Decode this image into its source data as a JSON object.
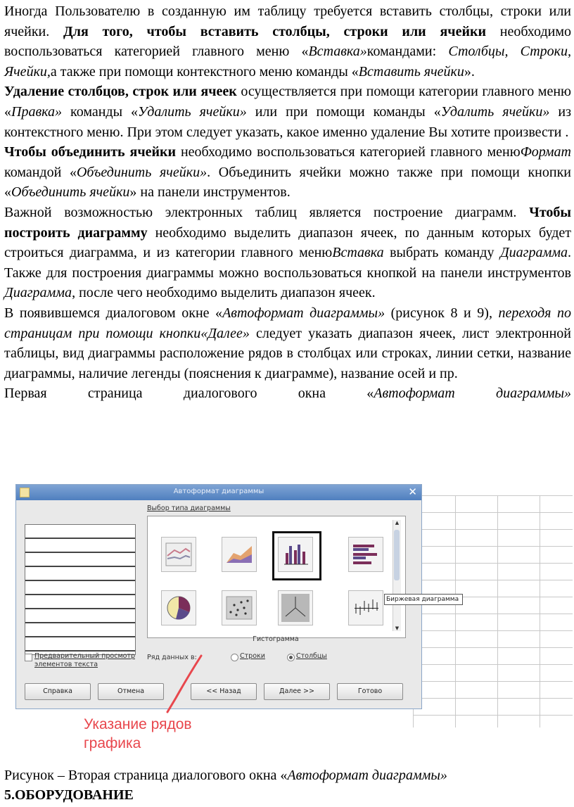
{
  "paragraphs": {
    "p1": {
      "t1": "Иногда Пользователю в созданную им таблицу требуется вставить столбцы, строки или ячейки. ",
      "b1": "Для того, чтобы вставить столбцы, строки или ячейки",
      "t2": " необходимо воспользоваться категорией главного меню «",
      "i1": "Вставка»",
      "t3": "командами: ",
      "i2": "Столбцы, Строки, Ячейки,",
      "t4": "а также при помощи контекстного меню команды «",
      "i3": "Вставить ячейки",
      "t5": "»."
    },
    "p2": {
      "b1": "Удаление столбцов, строк или ячеек",
      "t1": " осуществляется при помощи категории главного меню «",
      "i1": "Правка»",
      "t2": " команды «",
      "i2": "Удалить ячейки»",
      "t3": " или при помощи команды «",
      "i3": "Удалить ячейки»",
      "t4": " из контекстного меню. При этом следует указать, какое именно удаление Вы хотите произвести ."
    },
    "p3": {
      "b1": "Чтобы объединить ячейки",
      "t1": " необходимо воспользоваться категорией главного меню",
      "i1": "Формат",
      "t2": " командой «",
      "i2": "Объединить ячейки»",
      "t3": ". Объединить ячейки можно также при помощи кнопки «",
      "i3": "Объединить ячейки",
      "t4": "» на панели инструментов."
    },
    "p4": {
      "t1": "Важной возможностью электронных таблиц является построение диаграмм. ",
      "b1": "Чтобы построить диаграмму",
      "t2": " необходимо выделить диапазон ячеек, по данным которых будет строиться диаграмма, и из категории главного меню",
      "i1": "Вставка",
      "t3": " выбрать команду ",
      "i2": "Диаграмма",
      "t4": ". Также для построения диаграммы можно воспользоваться кнопкой на панели инструментов ",
      "i3": "Диаграмма",
      "t5": ", после чего необходимо выделить диапазон ячеек."
    },
    "p5": {
      "t1": "В появившемся диалоговом окне «",
      "i1": "Автоформат диаграммы»",
      "t2": " (рисунок 8 и 9)",
      "t3": ", переходя по страницам при помощи кнопки",
      "i2": "«Далее»",
      "t4": " следует указать диапазон ячеек, лист электронной таблицы, вид диаграммы расположение рядов в столбцах или строках, линии сетки, название диаграммы, наличие легенды (пояснения к диаграмме), название осей и пр."
    },
    "p6": {
      "t1": "Первая страница диалогового окна «",
      "i1": "Автоформат диаграммы»"
    }
  },
  "dialog": {
    "title": "Автоформат диаграммы",
    "close_glyph": "✕",
    "section_label": "Выбор типа диаграммы",
    "chart_types": [
      "line-chart",
      "area-chart",
      "column-chart",
      "bar-chart",
      "pie-chart",
      "scatter-chart",
      "net-chart",
      "stock-chart"
    ],
    "selected_type_caption": "Гистограмма",
    "tooltip": "Биржевая диаграмма",
    "preview_label": "Предварительный просмотр элементов текста",
    "series_label": "Ряд данных в:",
    "radio_rows": "Строки",
    "radio_columns": "Столбцы",
    "selected_series": "columns",
    "buttons": {
      "help": "Справка",
      "cancel": "Отмена",
      "back": "<< Назад",
      "next": "Далее >>",
      "finish": "Готово"
    }
  },
  "annotation": {
    "line1": "Указание рядов",
    "line2": "графика",
    "color": "#e8474d"
  },
  "caption": {
    "t1": "Рисунок  – Вторая страница диалогового окна «",
    "i1": "Автоформат диаграммы»"
  },
  "section_heading": "5.ОБОРУДОВАНИЕ"
}
